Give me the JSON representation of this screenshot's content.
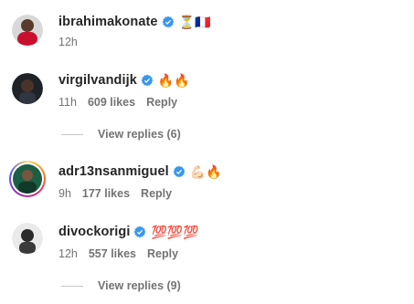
{
  "comments": [
    {
      "username": "ibrahimakonate",
      "content": "⏳🇫🇷",
      "time": "12h",
      "likes": "",
      "reply": "",
      "avatar_color": "#c8102e"
    },
    {
      "username": "virgilvandijk",
      "content": "🔥🔥",
      "time": "11h",
      "likes": "609 likes",
      "reply": "Reply",
      "avatar_color": "#1f2328"
    },
    {
      "username": "adr13nsanmiguel",
      "content": "💪🏻🔥",
      "time": "9h",
      "likes": "177 likes",
      "reply": "Reply",
      "avatar_color": "#0f3a2a"
    },
    {
      "username": "divockorigi",
      "content": "💯💯💯",
      "time": "12h",
      "likes": "557 likes",
      "reply": "Reply",
      "avatar_color": "#2a2a2a"
    }
  ],
  "view_replies": [
    "View replies (6)",
    "View replies (9)"
  ],
  "colors": {
    "verified": "#3897f0",
    "muted_text": "#737373",
    "text": "#262626"
  },
  "icons": {
    "verified": "verified-badge-icon"
  }
}
